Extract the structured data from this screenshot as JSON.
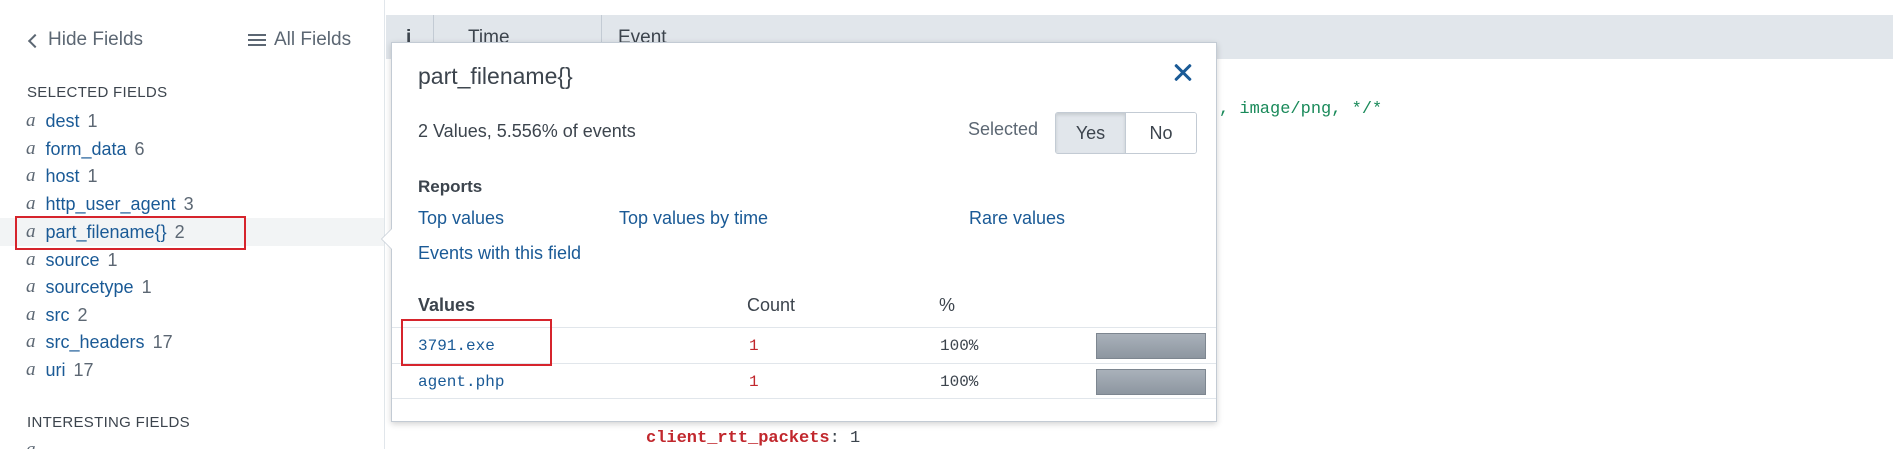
{
  "sidebar": {
    "hide_fields": "Hide Fields",
    "all_fields": "All Fields",
    "selected_heading": "SELECTED FIELDS",
    "interesting_heading": "INTERESTING FIELDS",
    "fields": [
      {
        "type": "a",
        "name": "dest",
        "count": "1"
      },
      {
        "type": "a",
        "name": "form_data",
        "count": "6"
      },
      {
        "type": "a",
        "name": "host",
        "count": "1"
      },
      {
        "type": "a",
        "name": "http_user_agent",
        "count": "3"
      },
      {
        "type": "a",
        "name": "part_filename{}",
        "count": "2"
      },
      {
        "type": "a",
        "name": "source",
        "count": "1"
      },
      {
        "type": "a",
        "name": "sourcetype",
        "count": "1"
      },
      {
        "type": "a",
        "name": "src",
        "count": "2"
      },
      {
        "type": "a",
        "name": "src_headers",
        "count": "17"
      },
      {
        "type": "a",
        "name": "uri",
        "count": "17"
      }
    ]
  },
  "results": {
    "columns": [
      "i",
      "Time",
      "Event"
    ],
    "event_fragment": ", image/png, */*",
    "event_key": "client_rtt_packets",
    "event_value": "1"
  },
  "popover": {
    "title": "part_filename{}",
    "summary": "2 Values, 5.556% of events",
    "selected_label": "Selected",
    "yes": "Yes",
    "no": "No",
    "reports_heading": "Reports",
    "report_links": [
      "Top values",
      "Top values by time",
      "Rare values",
      "Events with this field"
    ],
    "table_headers": {
      "values": "Values",
      "count": "Count",
      "percent": "%"
    },
    "rows": [
      {
        "value": "3791.exe",
        "count": "1",
        "percent": "100%",
        "fraction": 1.0
      },
      {
        "value": "agent.php",
        "count": "1",
        "percent": "100%",
        "fraction": 1.0
      }
    ]
  },
  "colors": {
    "link": "#1a5a96",
    "highlight": "#d6242c",
    "count_red": "#c1272d"
  }
}
